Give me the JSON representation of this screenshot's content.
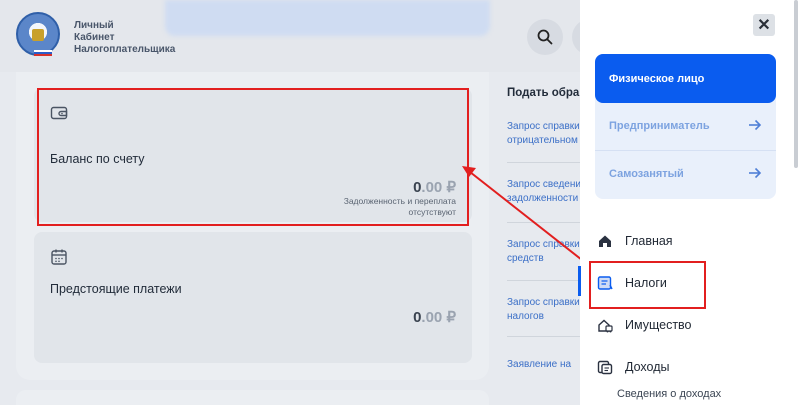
{
  "header": {
    "brand_line1": "Личный",
    "brand_line2": "Кабинет",
    "brand_line3": "Налогоплательщика"
  },
  "balance_card": {
    "title": "Баланс по счету",
    "amount_int": "0",
    "amount_dec": ".00 ₽",
    "note_line1": "Задолженность и переплата",
    "note_line2": "отсутствуют"
  },
  "upcoming_card": {
    "title": "Предстоящие платежи",
    "amount_int": "0",
    "amount_dec": ".00 ₽"
  },
  "side": {
    "title": "Подать обращение",
    "links": [
      [
        "Запрос справки об",
        "отрицательном"
      ],
      [
        "Запрос сведений о",
        "задолженности"
      ],
      [
        "Запрос справки о",
        "средств"
      ],
      [
        "Запрос справки о",
        "налогов"
      ],
      [
        "Заявление на"
      ]
    ]
  },
  "drawer": {
    "close_label": "✕",
    "segments": {
      "active": "Физическое лицо",
      "items": [
        "Предприниматель",
        "Самозанятый"
      ]
    },
    "nav": {
      "main": "Главная",
      "taxes": "Налоги",
      "property": "Имущество",
      "income": "Доходы",
      "income_sub": "Сведения о доходах"
    }
  },
  "colors": {
    "accent": "#0a5cef",
    "highlight": "#e21f1f",
    "link": "#3b6fc7"
  },
  "icons": {
    "search": "search-icon",
    "wallet": "wallet-icon",
    "calendar": "calendar-icon",
    "home": "home-icon",
    "taxes": "taxes-icon",
    "property": "property-icon",
    "income": "income-icon",
    "arrow_right": "arrow-right-icon",
    "close": "close-icon"
  }
}
